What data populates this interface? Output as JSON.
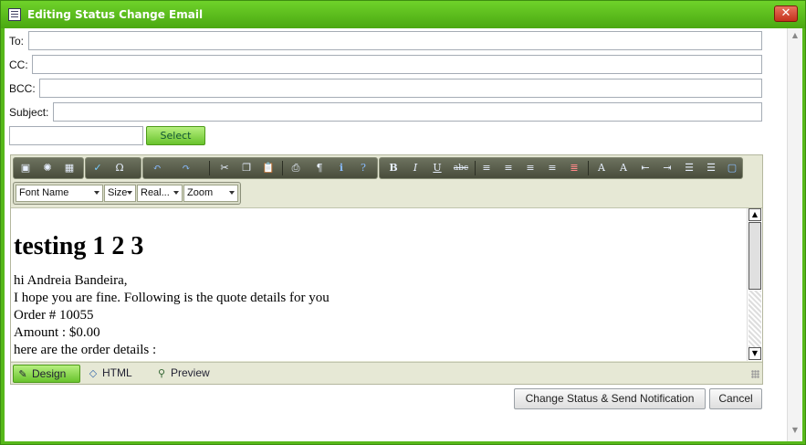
{
  "window": {
    "title": "Editing Status Change Email",
    "close_label": "✕"
  },
  "form": {
    "to_label": "To:",
    "cc_label": "CC:",
    "bcc_label": "BCC:",
    "subject_label": "Subject:",
    "to_value": "",
    "cc_value": "",
    "bcc_value": "",
    "subject_value": "",
    "template_value": "",
    "select_label": "Select"
  },
  "toolbar": {
    "buttons_row1": [
      {
        "name": "insert-image-icon",
        "glyph": "▣"
      },
      {
        "name": "insert-media-icon",
        "glyph": "✺"
      },
      {
        "name": "insert-table-icon",
        "glyph": "▦"
      },
      {
        "name": "spellcheck-icon",
        "glyph": "✓"
      },
      {
        "name": "special-char-icon",
        "glyph": "Ω"
      },
      {
        "name": "undo-icon",
        "glyph": "↶"
      },
      {
        "name": "redo-icon",
        "glyph": "↷"
      },
      {
        "name": "cut-icon",
        "glyph": "✂"
      },
      {
        "name": "copy-icon",
        "glyph": "❐"
      },
      {
        "name": "paste-icon",
        "glyph": "📋"
      },
      {
        "name": "print-icon",
        "glyph": "⎙"
      },
      {
        "name": "paragraph-icon",
        "glyph": "¶"
      },
      {
        "name": "info-icon",
        "glyph": "ℹ"
      },
      {
        "name": "help-icon",
        "glyph": "?"
      },
      {
        "name": "bold-icon",
        "glyph": "B"
      },
      {
        "name": "italic-icon",
        "glyph": "I"
      },
      {
        "name": "underline-icon",
        "glyph": "U"
      },
      {
        "name": "strikethrough-icon",
        "glyph": "abc"
      },
      {
        "name": "align-left-icon",
        "glyph": "≡"
      },
      {
        "name": "align-center-icon",
        "glyph": "≡"
      },
      {
        "name": "align-right-icon",
        "glyph": "≡"
      },
      {
        "name": "justify-icon",
        "glyph": "≡"
      },
      {
        "name": "horizontal-rule-icon",
        "glyph": "≣"
      },
      {
        "name": "clear-format-icon",
        "glyph": "A"
      },
      {
        "name": "format-stripper-icon",
        "glyph": "A"
      },
      {
        "name": "outdent-icon",
        "glyph": "⇤"
      },
      {
        "name": "indent-icon",
        "glyph": "⇥"
      },
      {
        "name": "ordered-list-icon",
        "glyph": "☰"
      },
      {
        "name": "unordered-list-icon",
        "glyph": "☰"
      },
      {
        "name": "module-manager-icon",
        "glyph": "▢"
      }
    ],
    "font_name": "Font Name",
    "size": "Size",
    "real": "Real...",
    "zoom": "Zoom"
  },
  "document": {
    "heading": "testing 1 2 3",
    "lines": [
      "hi Andreia Bandeira,",
      "I hope you are fine. Following is the quote details for you",
      "Order # 10055",
      "Amount : $0.00",
      "here are the order details :"
    ]
  },
  "modes": {
    "design": "Design",
    "html": "HTML",
    "preview": "Preview"
  },
  "actions": {
    "send_label": "Change Status & Send Notification",
    "cancel_label": "Cancel"
  }
}
